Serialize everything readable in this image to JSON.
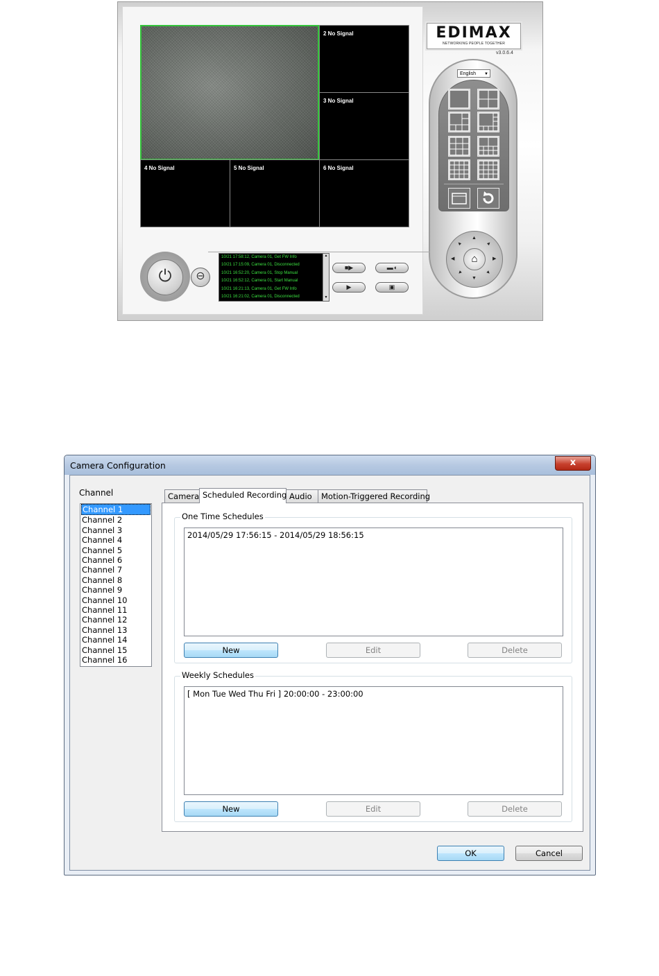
{
  "viewer": {
    "cells": [
      {
        "id": 1,
        "label": ""
      },
      {
        "id": 2,
        "label": "2 No Signal"
      },
      {
        "id": 3,
        "label": "3 No Signal"
      },
      {
        "id": 4,
        "label": "4 No Signal"
      },
      {
        "id": 5,
        "label": "5 No Signal"
      },
      {
        "id": 6,
        "label": "6 No Signal"
      }
    ],
    "logo_brand": "EDIMAX",
    "logo_tagline": "NETWORKING PEOPLE TOGETHER",
    "version": "v3.0.6.4",
    "language": "English",
    "event_log": [
      "10/21 17:58:12, Camera 01, Get FW Info",
      "10/21 17:15:09, Camera 01, Disconnected",
      "10/21 16:52:20, Camera 01, Stop Manual",
      "10/21 16:52:12, Camera 01, Start Manual",
      "10/21 16:21:13, Camera 01, Get FW Info",
      "10/21 16:21:02, Camera 01, Disconnected"
    ],
    "icons": {
      "power": "power-icon",
      "minimize": "minimize-icon",
      "camera": "video-camera-icon",
      "settings": "wrench-icon",
      "playback": "play-icon",
      "snapshot": "snapshot-icon",
      "fullscreen": "fullscreen-icon",
      "rotate": "refresh-icon",
      "home": "home-icon"
    },
    "accent_color": "#34c43b"
  },
  "dialog": {
    "title": "Camera Configuration",
    "close_label": "x",
    "channel_label": "Channel",
    "channels": [
      "Channel 1",
      "Channel 2",
      "Channel 3",
      "Channel 4",
      "Channel 5",
      "Channel 6",
      "Channel 7",
      "Channel 8",
      "Channel 9",
      "Channel 10",
      "Channel 11",
      "Channel 12",
      "Channel 13",
      "Channel 14",
      "Channel 15",
      "Channel 16"
    ],
    "selected_channel": "Channel 1",
    "tabs": [
      "Camera",
      "Scheduled Recording",
      "Audio",
      "Motion-Triggered Recording"
    ],
    "active_tab": "Scheduled Recording",
    "one_time": {
      "title": "One Time Schedules",
      "entries": [
        "2014/05/29 17:56:15 - 2014/05/29 18:56:15"
      ],
      "new_label": "New",
      "edit_label": "Edit",
      "delete_label": "Delete"
    },
    "weekly": {
      "title": "Weekly Schedules",
      "entries": [
        "[ Mon Tue Wed Thu Fri ] 20:00:00 - 23:00:00"
      ],
      "new_label": "New",
      "edit_label": "Edit",
      "delete_label": "Delete"
    },
    "ok_label": "OK",
    "cancel_label": "Cancel"
  }
}
